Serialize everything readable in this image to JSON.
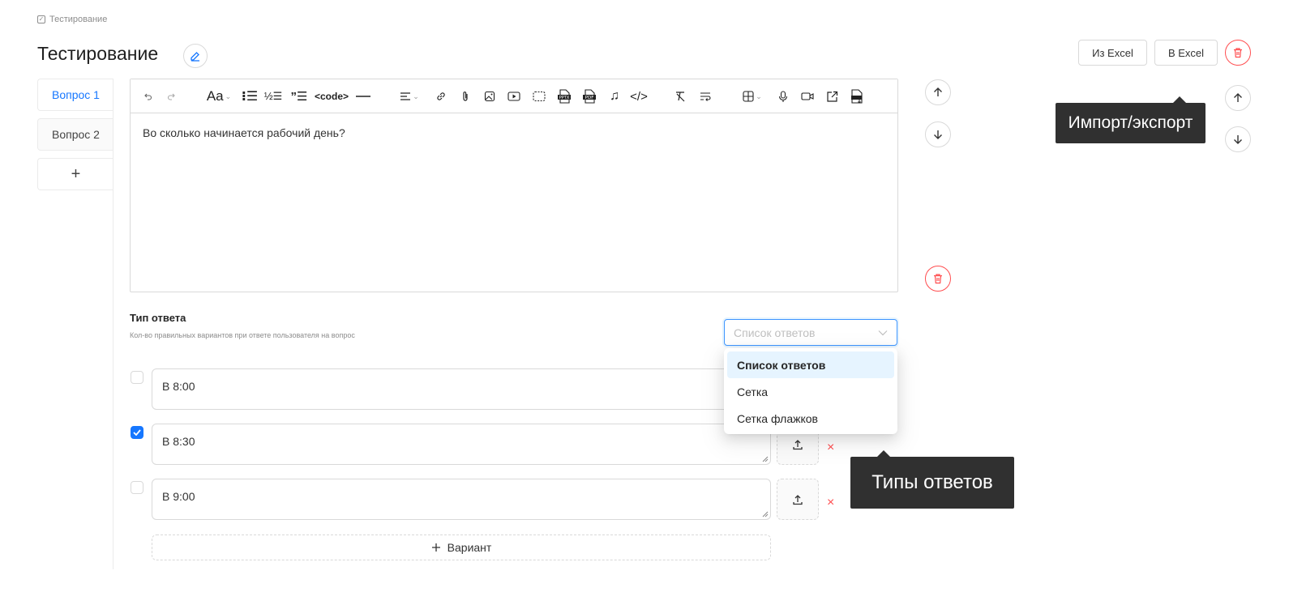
{
  "breadcrumb": {
    "label": "Тестирование"
  },
  "page": {
    "title": "Тестирование"
  },
  "header_actions": {
    "import_label": "Из Excel",
    "export_label": "В Excel"
  },
  "tabs": {
    "items": [
      {
        "label": "Вопрос 1",
        "active": true
      },
      {
        "label": "Вопрос 2",
        "active": false
      }
    ],
    "add_label": "+"
  },
  "editor": {
    "toolbar": {
      "font_label": "Aa",
      "code_label": "<code>",
      "html_label": "</>"
    },
    "content": "Во сколько начинается рабочий день?"
  },
  "answer_type": {
    "title": "Тип ответа",
    "subtitle": "Кол-во правильных вариантов при ответе пользователя на вопрос",
    "select_placeholder": "Список ответов",
    "options": [
      {
        "label": "Список ответов",
        "selected": true
      },
      {
        "label": "Сетка",
        "selected": false
      },
      {
        "label": "Сетка флажков",
        "selected": false
      }
    ]
  },
  "answers": [
    {
      "text": "В 8:00",
      "checked": false
    },
    {
      "text": "В 8:30",
      "checked": true
    },
    {
      "text": "В 9:00",
      "checked": false
    }
  ],
  "add_variant_label": "Вариант",
  "remove_label": "×",
  "tooltips": {
    "import_export": "Импорт/экспорт",
    "answer_types": "Типы ответов"
  },
  "colors": {
    "primary": "#1677ff",
    "danger": "#ff4d4f",
    "tooltip_bg": "#303030"
  },
  "icons": {
    "edit": "pencil-icon",
    "delete": "trash-icon",
    "up": "arrow-up-icon",
    "down": "arrow-down-icon",
    "upload": "upload-icon",
    "add": "plus-icon",
    "check": "checkmark-icon"
  }
}
